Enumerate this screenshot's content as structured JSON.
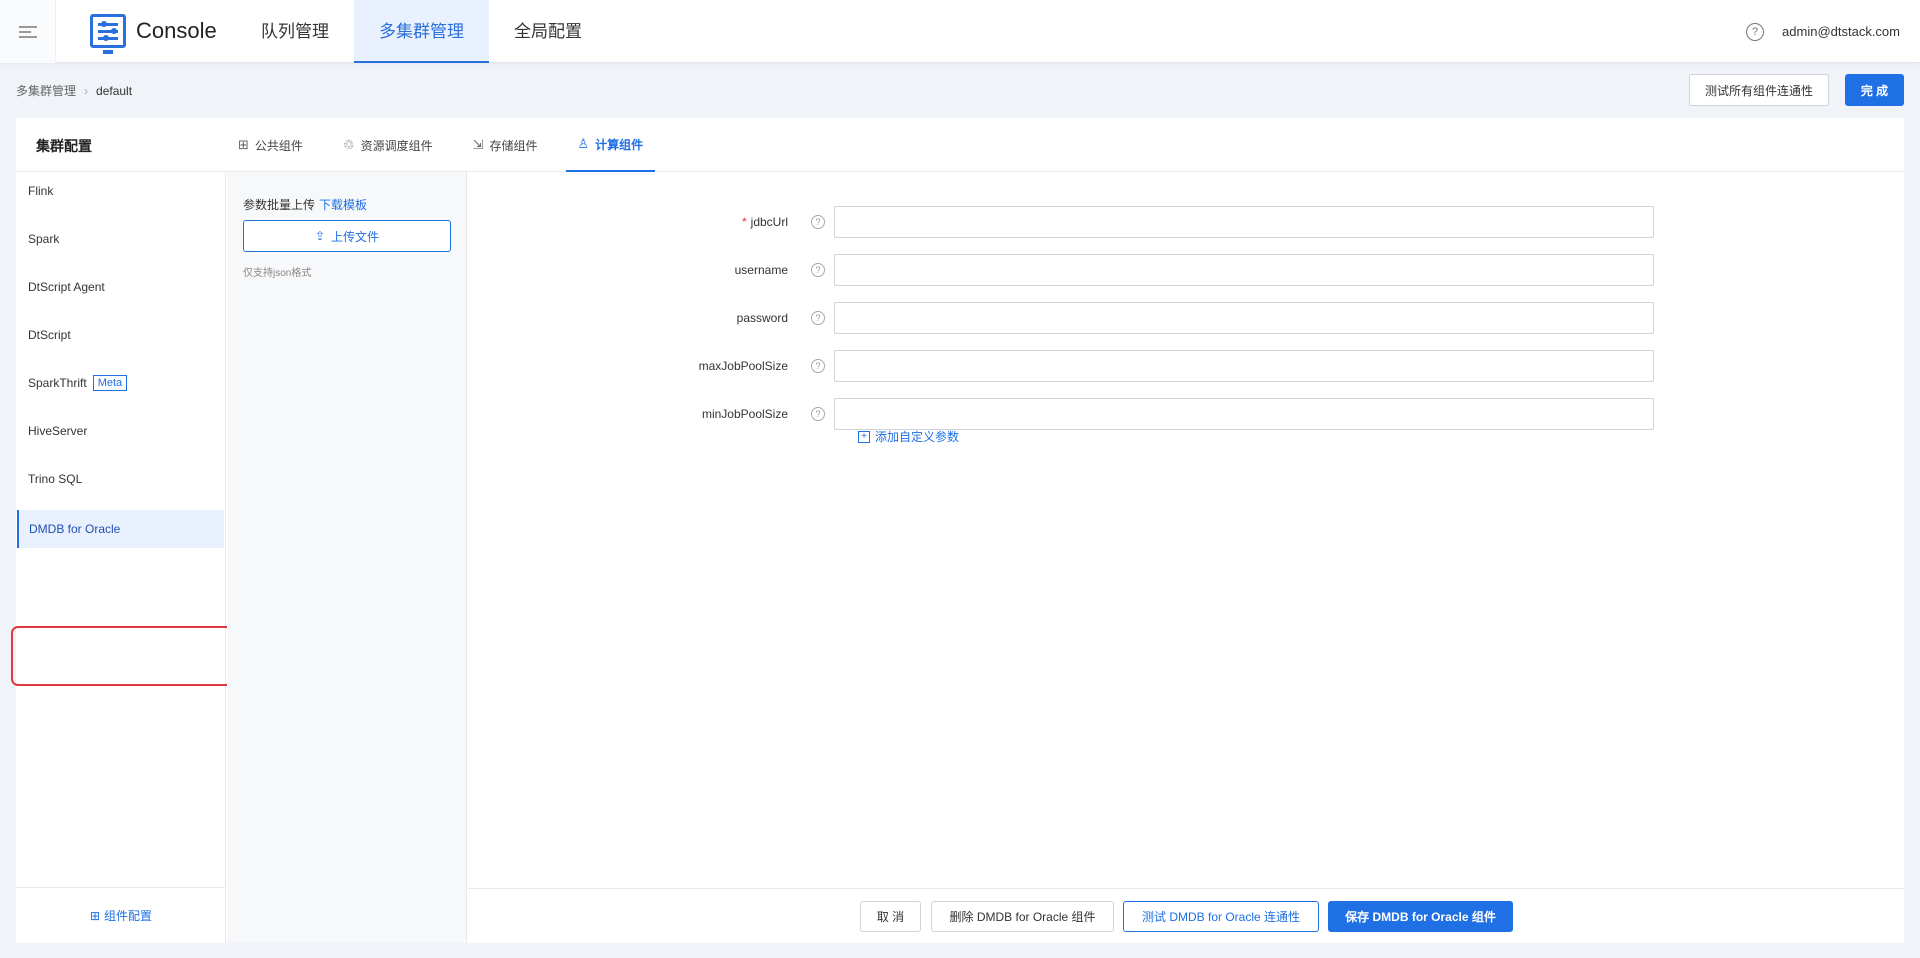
{
  "header": {
    "brand_title": "Console",
    "nav": [
      "队列管理",
      "多集群管理",
      "全局配置"
    ],
    "active_nav_index": 1,
    "user_email": "admin@dtstack.com"
  },
  "breadcrumb": {
    "parent": "多集群管理",
    "current": "default"
  },
  "actions": {
    "test_all_label": "测试所有组件连通性",
    "finish_label": "完 成"
  },
  "card": {
    "title": "集群配置",
    "tabs": [
      {
        "label": "公共组件",
        "icon": "grid-icon"
      },
      {
        "label": "资源调度组件",
        "icon": "recycle-icon"
      },
      {
        "label": "存储组件",
        "icon": "export-icon"
      },
      {
        "label": "计算组件",
        "icon": "user-icon"
      }
    ],
    "active_tab_index": 3
  },
  "sidebar": {
    "items": [
      {
        "label": "Flink"
      },
      {
        "label": "Spark"
      },
      {
        "label": "DtScript Agent"
      },
      {
        "label": "DtScript"
      },
      {
        "label": "SparkThrift",
        "tag": "Meta"
      },
      {
        "label": "HiveServer"
      },
      {
        "label": "Trino SQL"
      },
      {
        "label": "DMDB for Oracle"
      }
    ],
    "active_index": 7,
    "footer_label": "组件配置"
  },
  "upload": {
    "title": "参数批量上传",
    "download_link": "下载模板",
    "button_label": "上传文件",
    "hint": "仅支持json格式"
  },
  "form": {
    "fields": [
      {
        "label": "jdbcUrl",
        "required": true,
        "value": ""
      },
      {
        "label": "username",
        "required": false,
        "value": ""
      },
      {
        "label": "password",
        "required": false,
        "value": ""
      },
      {
        "label": "maxJobPoolSize",
        "required": false,
        "value": ""
      },
      {
        "label": "minJobPoolSize",
        "required": false,
        "value": ""
      }
    ],
    "add_param_label": "添加自定义参数"
  },
  "footer": {
    "cancel_label": "取 消",
    "delete_label": "删除 DMDB for Oracle 组件",
    "test_label": "测试 DMDB for Oracle 连通性",
    "save_label": "保存 DMDB for Oracle 组件"
  },
  "colors": {
    "primary": "#1f6fe5",
    "highlight_border": "#e0383e"
  }
}
